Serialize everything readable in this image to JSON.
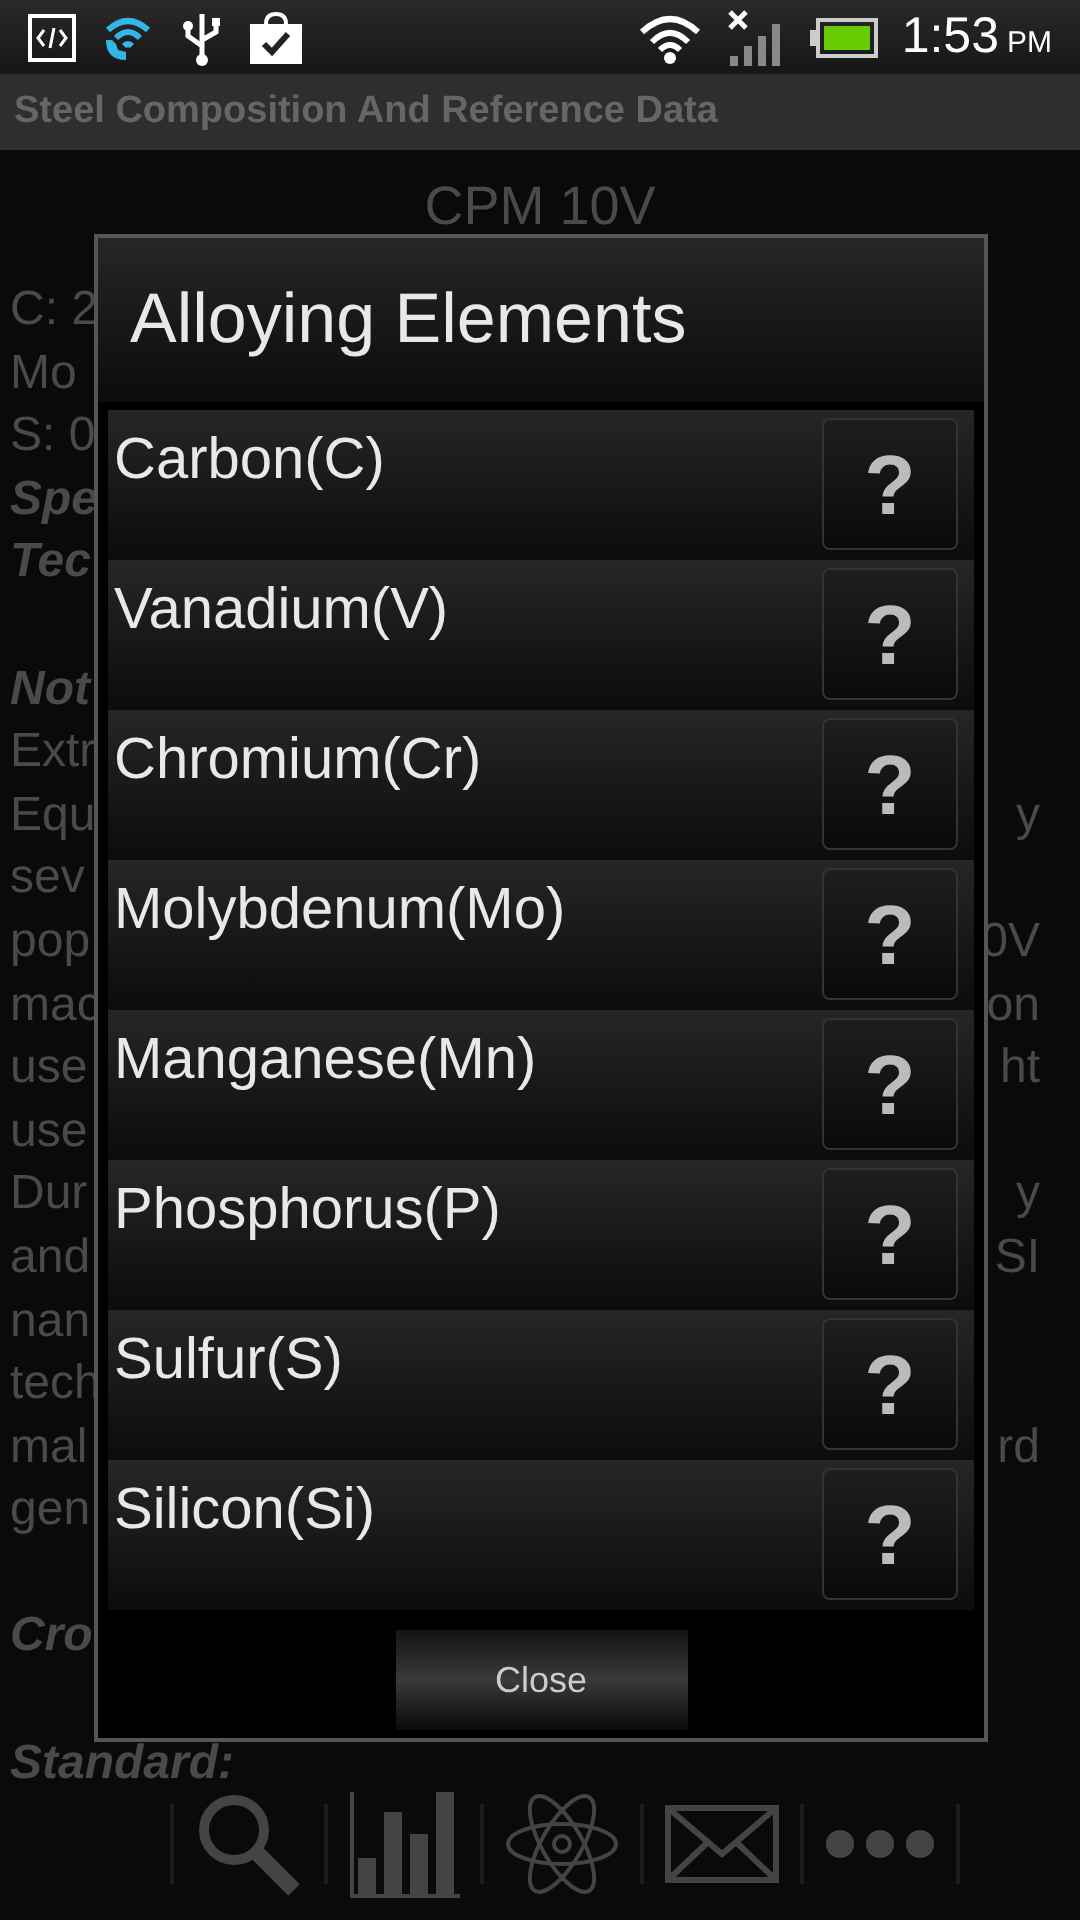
{
  "status_bar": {
    "time": "1:53",
    "ampm": "PM"
  },
  "app_bar": {
    "title": "Steel Composition And Reference Data"
  },
  "steel": {
    "name": "CPM 10V"
  },
  "background_lines": [
    {
      "kind": "plain",
      "left": "C: 2"
    },
    {
      "kind": "plain",
      "left": "Mo"
    },
    {
      "kind": "plain",
      "left": "S: 0"
    },
    {
      "kind": "heading",
      "left": "Spe"
    },
    {
      "kind": "heading",
      "left": "Tec"
    },
    {
      "kind": "blank"
    },
    {
      "kind": "heading",
      "left": "Not"
    },
    {
      "kind": "plain",
      "left": "Extr"
    },
    {
      "kind": "plain",
      "left": "Equ",
      "right": "y"
    },
    {
      "kind": "plain",
      "left": "sev"
    },
    {
      "kind": "plain",
      "left": "pop",
      "right": "0V"
    },
    {
      "kind": "plain",
      "left": "mac",
      "right": "on"
    },
    {
      "kind": "plain",
      "left": "use",
      "right": "ht"
    },
    {
      "kind": "plain",
      "left": "use"
    },
    {
      "kind": "plain",
      "left": "Dur",
      "right": "y"
    },
    {
      "kind": "plain",
      "left": "and",
      "right": "SI"
    },
    {
      "kind": "plain",
      "left": "nan"
    },
    {
      "kind": "plain",
      "left": "tech"
    },
    {
      "kind": "plain",
      "left": "mal",
      "right": "rd"
    },
    {
      "kind": "plain",
      "left": "gen"
    },
    {
      "kind": "blank"
    },
    {
      "kind": "heading",
      "left": "Cro"
    },
    {
      "kind": "blank"
    },
    {
      "kind": "heading",
      "left": "Standard:"
    }
  ],
  "dialog": {
    "title": "Alloying Elements",
    "elements": [
      {
        "name": "Carbon(C)",
        "help": "?"
      },
      {
        "name": "Vanadium(V)",
        "help": "?"
      },
      {
        "name": "Chromium(Cr)",
        "help": "?"
      },
      {
        "name": "Molybdenum(Mo)",
        "help": "?"
      },
      {
        "name": "Manganese(Mn)",
        "help": "?"
      },
      {
        "name": "Phosphorus(P)",
        "help": "?"
      },
      {
        "name": "Sulfur(S)",
        "help": "?"
      },
      {
        "name": "Silicon(Si)",
        "help": "?"
      }
    ],
    "close": "Close"
  }
}
